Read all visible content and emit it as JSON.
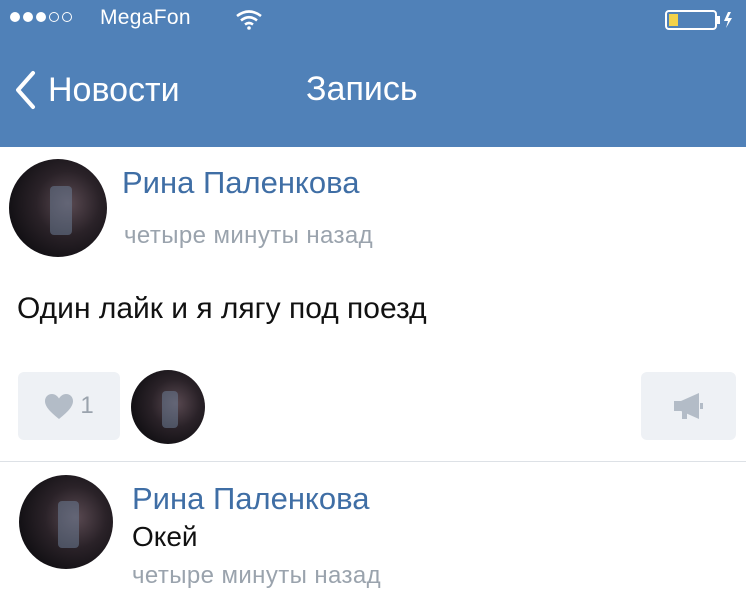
{
  "status_bar": {
    "carrier": "MegaFon"
  },
  "nav": {
    "back_label": "Новости",
    "title": "Запись"
  },
  "post": {
    "author": "Рина Паленкова",
    "time": "четыре минуты назад",
    "text": "Один лайк и я лягу под поезд",
    "likes": "1"
  },
  "comment": {
    "author": "Рина Паленкова",
    "text": "Окей",
    "time": "четыре минуты назад"
  },
  "colors": {
    "nav_bg": "#5081b8",
    "link": "#3f6ea5",
    "muted": "#9aa3ad"
  },
  "icons": [
    "signal-dots-icon",
    "wifi-icon",
    "battery-icon",
    "chevron-left-icon",
    "heart-icon",
    "megaphone-icon"
  ]
}
